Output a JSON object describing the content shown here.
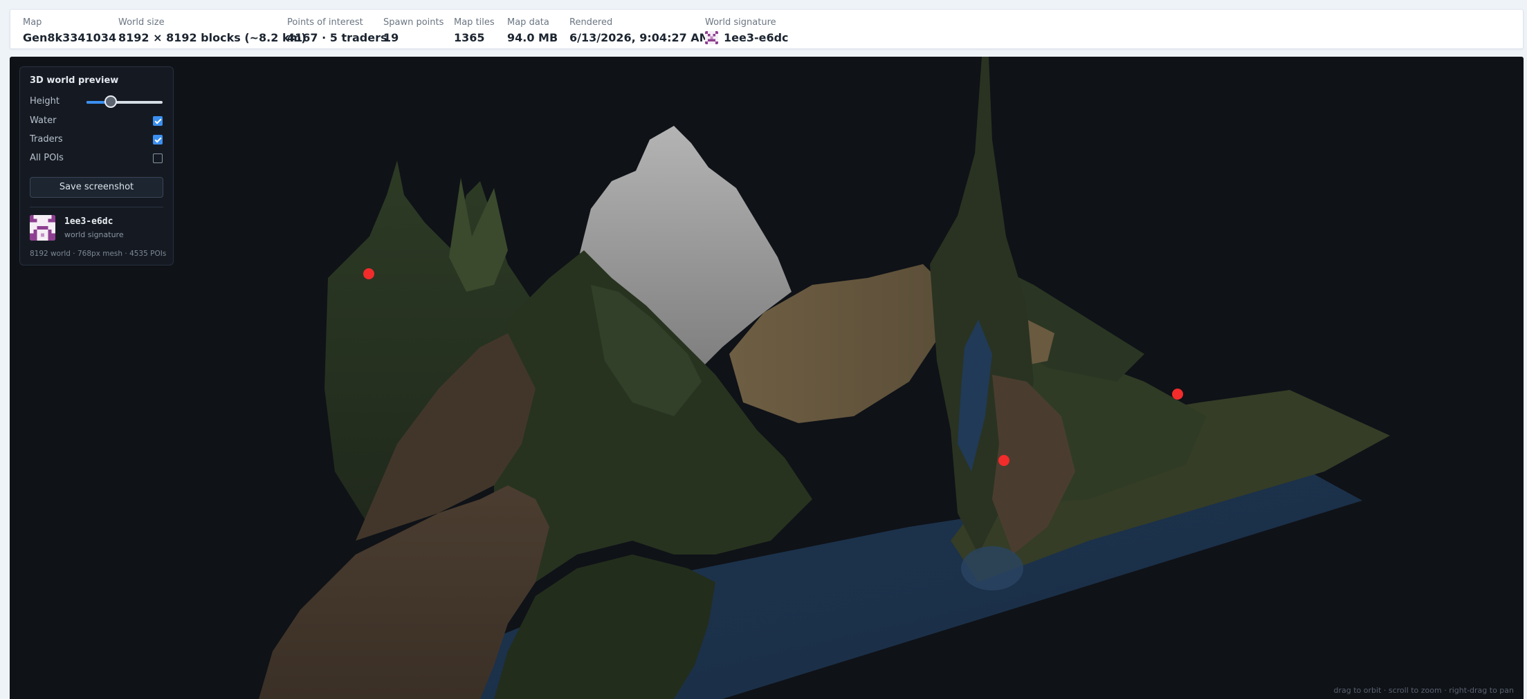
{
  "stats": [
    {
      "label": "Map",
      "value": "Gen8k3341034"
    },
    {
      "label": "World size",
      "value": "8192 × 8192 blocks (~8.2 km)"
    },
    {
      "label": "Points of interest",
      "value": "4167 · 5 traders"
    },
    {
      "label": "Spawn points",
      "value": "19"
    },
    {
      "label": "Map tiles",
      "value": "1365"
    },
    {
      "label": "Map data",
      "value": "94.0 MB"
    },
    {
      "label": "Rendered",
      "value": "6/13/2026, 9:04:27 AM"
    },
    {
      "label": "World signature",
      "value": "1ee3-e6dc"
    }
  ],
  "panel": {
    "title": "3D world preview",
    "height_label": "Height",
    "height_value": 0.32,
    "toggles": [
      {
        "label": "Water",
        "checked": true
      },
      {
        "label": "Traders",
        "checked": true
      },
      {
        "label": "All POIs",
        "checked": false
      }
    ],
    "screenshot_button": "Save screenshot",
    "signature_code": "1ee3-e6dc",
    "signature_caption": "world signature",
    "footer": "8192 world · 768px mesh · 4535 POIs"
  },
  "viewport_hint": "drag to orbit · scroll to zoom · right-drag to pan",
  "colors": {
    "accent": "#3b8ff0",
    "trader_marker": "#f22b2b",
    "signature_purple": "#8e3f91"
  },
  "icons": {
    "signature": "pixel-identicon"
  }
}
